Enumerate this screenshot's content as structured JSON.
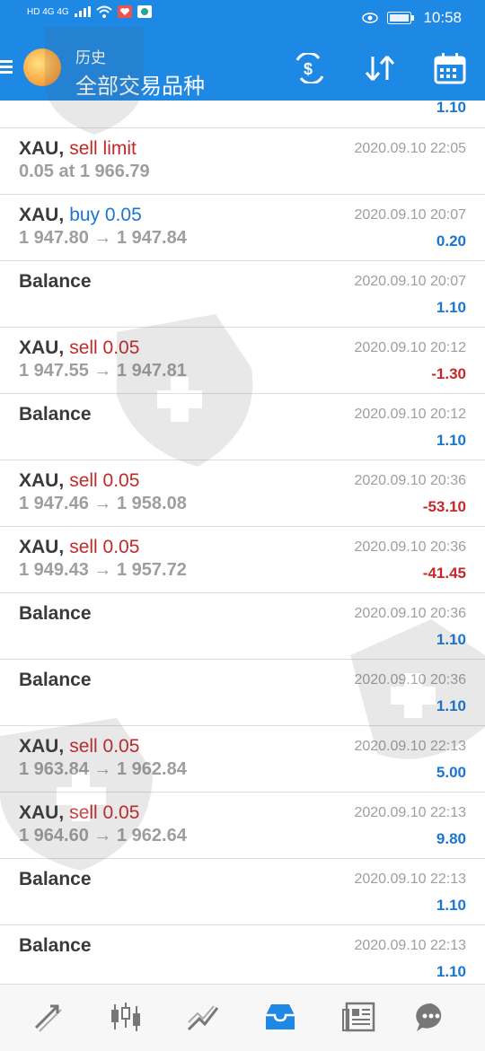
{
  "status_bar": {
    "left_text": "HD 4G 4G",
    "time": "10:58"
  },
  "header": {
    "subtitle": "历史",
    "title": "全部交易品种"
  },
  "rows": [
    {
      "symbol": "XAU,",
      "action": "sell limit",
      "action_color": "red",
      "detail": "0.05 at 1 966.79",
      "time": "2020.09.10 22:05",
      "amount": ""
    },
    {
      "symbol": "XAU,",
      "action": "buy 0.05",
      "action_color": "blue",
      "detail": "1 947.80 → 1 947.84",
      "time": "2020.09.10 20:07",
      "amount": "0.20",
      "amount_sign": "pos"
    },
    {
      "symbol": "Balance",
      "action": "",
      "detail": "",
      "time": "2020.09.10 20:07",
      "amount": "1.10",
      "amount_sign": "pos"
    },
    {
      "symbol": "XAU,",
      "action": "sell 0.05",
      "action_color": "red",
      "detail": "1 947.55 → 1 947.81",
      "time": "2020.09.10 20:12",
      "amount": "-1.30",
      "amount_sign": "neg"
    },
    {
      "symbol": "Balance",
      "action": "",
      "detail": "",
      "time": "2020.09.10 20:12",
      "amount": "1.10",
      "amount_sign": "pos"
    },
    {
      "symbol": "XAU,",
      "action": "sell 0.05",
      "action_color": "red",
      "detail": "1 947.46 → 1 958.08",
      "time": "2020.09.10 20:36",
      "amount": "-53.10",
      "amount_sign": "neg"
    },
    {
      "symbol": "XAU,",
      "action": "sell 0.05",
      "action_color": "red",
      "detail": "1 949.43 → 1 957.72",
      "time": "2020.09.10 20:36",
      "amount": "-41.45",
      "amount_sign": "neg"
    },
    {
      "symbol": "Balance",
      "action": "",
      "detail": "",
      "time": "2020.09.10 20:36",
      "amount": "1.10",
      "amount_sign": "pos"
    },
    {
      "symbol": "Balance",
      "action": "",
      "detail": "",
      "time": "2020.09.10 20:36",
      "amount": "1.10",
      "amount_sign": "pos"
    },
    {
      "symbol": "XAU,",
      "action": "sell 0.05",
      "action_color": "red",
      "detail": "1 963.84 → 1 962.84",
      "time": "2020.09.10 22:13",
      "amount": "5.00",
      "amount_sign": "pos"
    },
    {
      "symbol": "XAU,",
      "action": "sell 0.05",
      "action_color": "red",
      "detail": "1 964.60 → 1 962.64",
      "time": "2020.09.10 22:13",
      "amount": "9.80",
      "amount_sign": "pos"
    },
    {
      "symbol": "Balance",
      "action": "",
      "detail": "",
      "time": "2020.09.10 22:13",
      "amount": "1.10",
      "amount_sign": "pos"
    },
    {
      "symbol": "Balance",
      "action": "",
      "detail": "",
      "time": "2020.09.10 22:13",
      "amount": "1.10",
      "amount_sign": "pos"
    }
  ],
  "top_partial_amount": "1.10",
  "toolbar_icons": [
    "currency-exchange-icon",
    "sort-icon",
    "calendar-icon"
  ],
  "nav_icons": [
    "quotes-icon",
    "chart-icon",
    "trade-icon",
    "history-icon",
    "news-icon",
    "chat-icon"
  ],
  "colors": {
    "accent": "#1e88e5",
    "sell": "#c62828",
    "buy": "#1976d2",
    "active_nav": "#1e88e5"
  }
}
